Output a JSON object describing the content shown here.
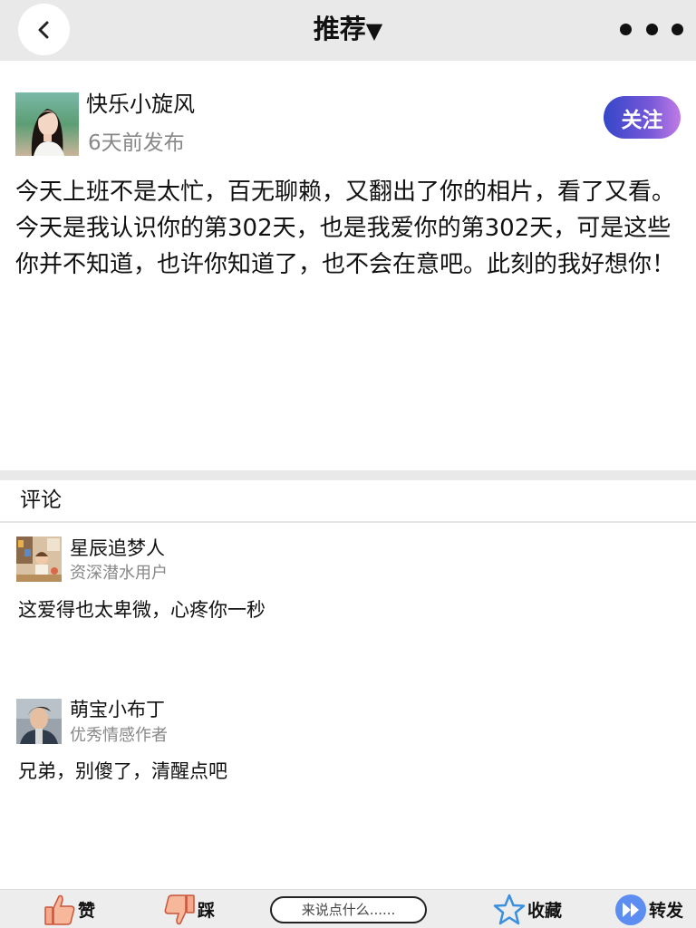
{
  "header": {
    "title": "推荐",
    "title_caret": "▼",
    "back_icon": "chevron-left-icon",
    "more_icon": "more-dots-icon"
  },
  "author": {
    "name": "快乐小旋风",
    "time": "6天前发布",
    "follow_label": "关注"
  },
  "post": {
    "text": "今天上班不是太忙，百无聊赖，又翻出了你的相片，看了又看。今天是我认识你的第302天，也是我爱你的第302天，可是这些你并不知道，也许你知道了，也不会在意吧。此刻的我好想你！"
  },
  "comments": {
    "title": "评论",
    "items": [
      {
        "name": "星辰追梦人",
        "badge": "资深潜水用户",
        "text": "这爱得也太卑微，心疼你一秒"
      },
      {
        "name": "萌宝小布丁",
        "badge": "优秀情感作者",
        "text": "兄弟，别傻了，清醒点吧"
      }
    ]
  },
  "bottom_bar": {
    "like_label": "赞",
    "dislike_label": "踩",
    "input_placeholder": "来说点什么......",
    "favorite_label": "收藏",
    "share_label": "转发"
  },
  "colors": {
    "topbar_bg": "#e9e9e9",
    "follow_gradient_start": "#3546c9",
    "follow_gradient_end": "#c07be6",
    "secondary_text": "#888888"
  }
}
